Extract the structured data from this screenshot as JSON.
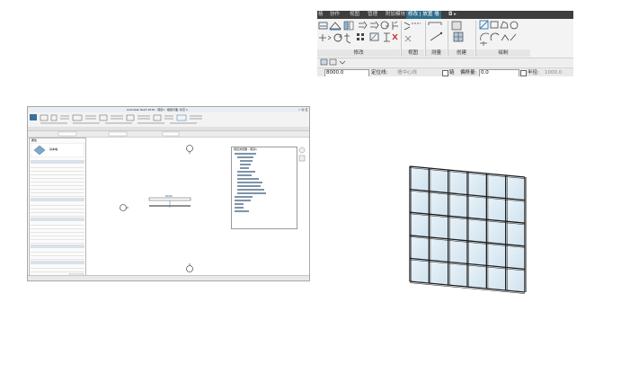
{
  "ribbon_zoom": {
    "tabs": [
      "格",
      "协作",
      "视图",
      "管理",
      "附加模块",
      "修改 | 放置 墙",
      "◘ ▸"
    ],
    "active_tab_index": 5,
    "groups": [
      "修改",
      "视图",
      "测量",
      "创建",
      "绘制"
    ],
    "options": {
      "value_field": "8000.0",
      "link_label": "定位线:",
      "link_value": "墙中心线",
      "chain_label": "链",
      "offset_label": "偏移量:",
      "offset_value": "0.0",
      "radius_label": "半径:",
      "radius_value": "1000.0"
    }
  },
  "app_window": {
    "title": "Autodesk Revit 2016 - 项目1 - 楼层平面: 标高 1",
    "properties_title": "属性",
    "type_name": "基本墙",
    "browser_title": "项目浏览器 - 项目1",
    "dimension_label": "8000"
  },
  "colors": {
    "tab_bar": "#3e3e3e",
    "active_tab": "#2f6e8c",
    "glass": "#dbeaf3",
    "mullion": "#1c1c1c"
  }
}
